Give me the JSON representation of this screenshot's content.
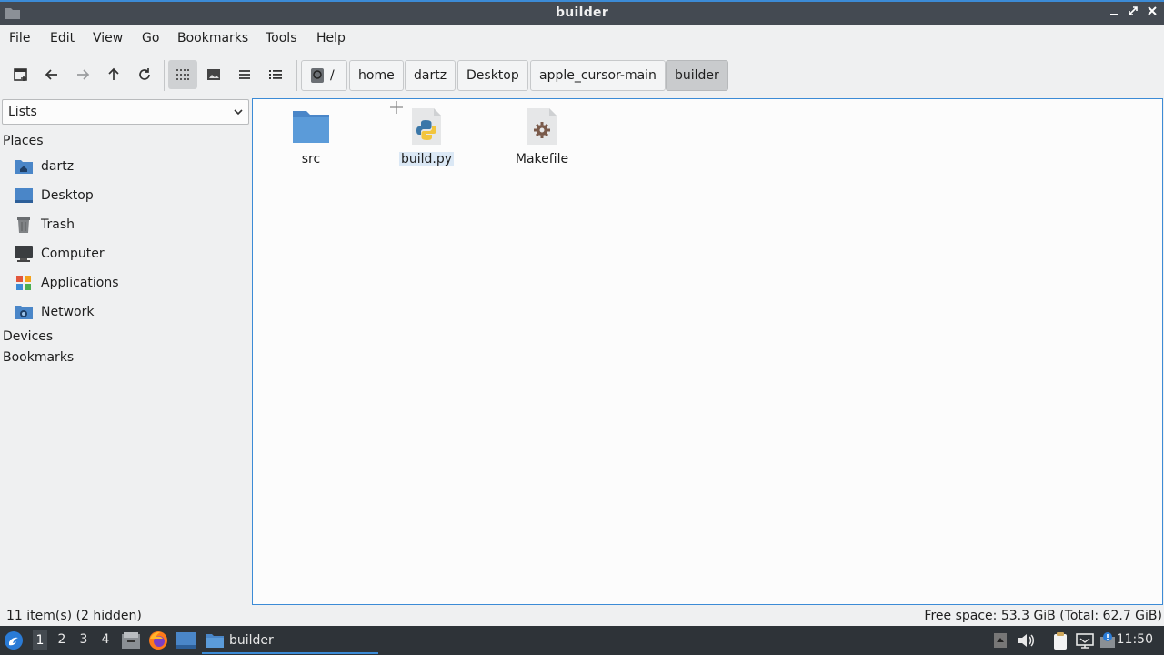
{
  "window": {
    "title": "builder"
  },
  "menu": [
    "File",
    "Edit",
    "View",
    "Go",
    "Bookmarks",
    "Tools",
    "Help"
  ],
  "breadcrumbs": [
    "/",
    "home",
    "dartz",
    "Desktop",
    "apple_cursor-main",
    "builder"
  ],
  "sidebar": {
    "mode": "Lists",
    "places_heading": "Places",
    "places": [
      {
        "label": "dartz",
        "icon": "home-folder-icon"
      },
      {
        "label": "Desktop",
        "icon": "desktop-icon"
      },
      {
        "label": "Trash",
        "icon": "trash-icon"
      },
      {
        "label": "Computer",
        "icon": "computer-icon"
      },
      {
        "label": "Applications",
        "icon": "applications-icon"
      },
      {
        "label": "Network",
        "icon": "network-icon"
      }
    ],
    "devices_heading": "Devices",
    "bookmarks_heading": "Bookmarks"
  },
  "files": [
    {
      "name": "src",
      "icon": "folder-icon"
    },
    {
      "name": "build.py",
      "icon": "python-file-icon"
    },
    {
      "name": "Makefile",
      "icon": "makefile-icon"
    }
  ],
  "status": {
    "left": "11 item(s) (2 hidden)",
    "right": "Free space: 53.3 GiB (Total: 62.7 GiB)"
  },
  "taskbar": {
    "workspaces": [
      "1",
      "2",
      "3",
      "4"
    ],
    "active_workspace": "1",
    "task_label": "builder",
    "clock": "11:50"
  },
  "colors": {
    "accent": "#3c8bd6",
    "titlebar": "#444a52",
    "taskbar": "#2e3338"
  }
}
